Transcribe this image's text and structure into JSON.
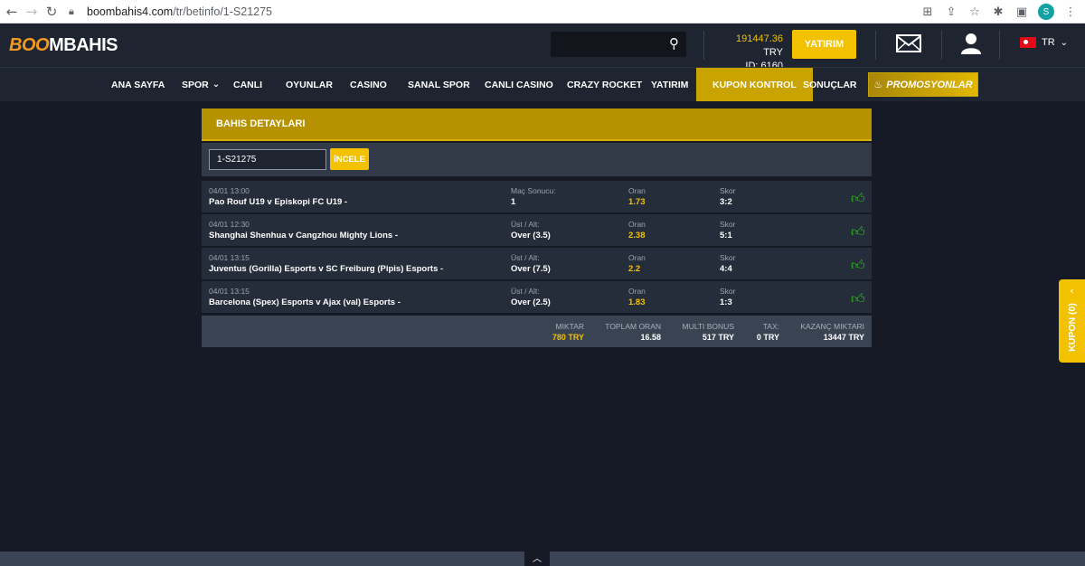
{
  "browser": {
    "url_domain": "boombahis4.com",
    "url_path": "/tr/betinfo/1-S21275",
    "profile_initial": "S"
  },
  "header": {
    "logo_flame": "B",
    "logo_oo": "OO",
    "logo_m": "M",
    "logo_rest": "BAHIS",
    "balance_amount": "191447.36",
    "balance_currency": "TRY",
    "user_id": "ID: 6160",
    "deposit_label": "YATIRIM",
    "language": "TR"
  },
  "nav": {
    "items": [
      "ANA SAYFA",
      "SPOR",
      "CANLI",
      "OYUNLAR",
      "CASINO",
      "SANAL SPOR",
      "CANLI CASINO",
      "CRAZY ROCKET",
      "YATIRIM",
      "KUPON KONTROL",
      "SONUÇLAR"
    ],
    "promo_label": "PROMOSYONLAR"
  },
  "panel": {
    "title": "BAHIS DETAYLARI",
    "coupon_value": "1-S21275",
    "inspect_label": "İNCELE"
  },
  "bets": [
    {
      "time": "04/01 13:00",
      "match": "Pao Rouf U19 v Episkopi FC U19 -",
      "market": "Maç Sonucu:",
      "pick": "1",
      "odd_label": "Oran",
      "odd": "1.73",
      "score_label": "Skor",
      "score": "3:2"
    },
    {
      "time": "04/01 12:30",
      "match": "Shanghai Shenhua v Cangzhou Mighty Lions -",
      "market": "Üst / Alt:",
      "pick": "Over (3.5)",
      "odd_label": "Oran",
      "odd": "2.38",
      "score_label": "Skor",
      "score": "5:1"
    },
    {
      "time": "04/01 13:15",
      "match": "Juventus (Gorilla) Esports v SC Freiburg (Pipis) Esports -",
      "market": "Üst / Alt:",
      "pick": "Over (7.5)",
      "odd_label": "Oran",
      "odd": "2.2",
      "score_label": "Skor",
      "score": "4:4"
    },
    {
      "time": "04/01 13:15",
      "match": "Barcelona (Spex) Esports v Ajax (val) Esports -",
      "market": "Üst / Alt:",
      "pick": "Over (2.5)",
      "odd_label": "Oran",
      "odd": "1.83",
      "score_label": "Skor",
      "score": "1:3"
    }
  ],
  "summary": {
    "amount_label": "MIKTAR",
    "amount": "780 TRY",
    "total_odds_label": "TOPLAM ORAN",
    "total_odds": "16.58",
    "multi_bonus_label": "MULTI BONUS",
    "multi_bonus": "517 TRY",
    "tax_label": "TAX:",
    "tax": "0 TRY",
    "winnings_label": "KAZANÇ MIKTARI",
    "winnings": "13447 TRY"
  },
  "kupon": {
    "label": "KUPON  (0)"
  },
  "colors": {
    "gold": "#f2c200",
    "panel_gold": "#b69200",
    "win_green": "#2ec21d",
    "bg": "#161a25"
  }
}
